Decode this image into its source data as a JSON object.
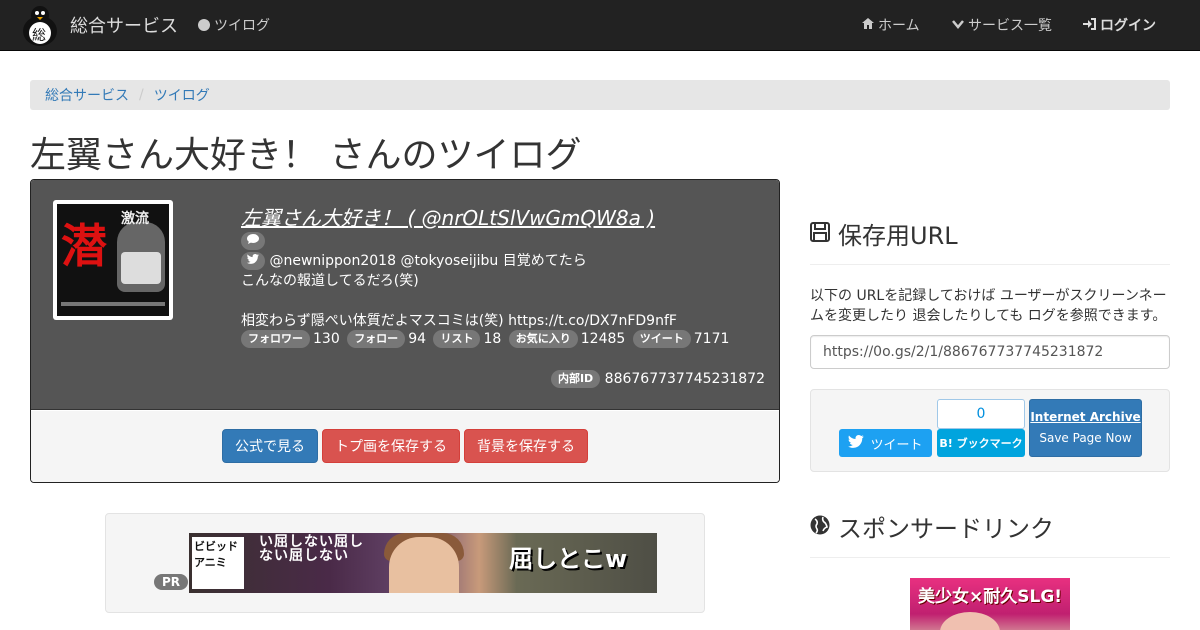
{
  "navbar": {
    "brand": "総合サービス",
    "logo_text": "総",
    "twilog_link": "ツイログ",
    "home": "ホーム",
    "services": "サービス一覧",
    "login": "ログイン"
  },
  "breadcrumb": [
    "総合サービス",
    "ツイログ"
  ],
  "page_title": "左翼さん大好き！ さんのツイログ",
  "profile": {
    "avatar_text": "潜",
    "avatar_tag": "激流",
    "display_name": "左翼さん大好き！ ( @nrOLtSlVwGmQW8a )",
    "tweet_line1": "@newnippon2018 @tokyoseijibu 目覚めてたら",
    "tweet_line2": "こんなの報道してるだろ(笑)",
    "tweet_line3": "相変わらず隠ぺい体質だよマスコミは(笑) https://t.co/DX7nFD9nfF",
    "stats": [
      {
        "label": "フォロワー",
        "value": "130"
      },
      {
        "label": "フォロー",
        "value": "94"
      },
      {
        "label": "リスト",
        "value": "18"
      },
      {
        "label": "お気に入り",
        "value": "12485"
      },
      {
        "label": "ツイート",
        "value": "7171"
      }
    ],
    "internal_id_label": "内部ID",
    "internal_id": "886767737745231872"
  },
  "buttons": {
    "official": "公式で見る",
    "save_icon": "トプ画を保存する",
    "save_bg": "背景を保存する"
  },
  "ad": {
    "pr": "PR",
    "logo_text": "ビビッドアニミ",
    "side_text": "い屈しない屈しない屈しない",
    "title": "屈しとこw"
  },
  "sidebar": {
    "save_url_heading": "保存用URL",
    "save_url_desc": "以下の URLを記録しておけば ユーザーがスクリーンネームを変更したり 退会したりしても ログを参照できます。",
    "save_url": "https://0o.gs/2/1/886767737745231872",
    "tweet_button": "ツイート",
    "hatena_count": "0",
    "hatena_button": "B! ブックマーク",
    "ia_title": "Internet Archive",
    "ia_sub": "Save Page Now",
    "sponsor_heading": "スポンサードリンク",
    "sponsor_ad_text": "美少女×耐久SLG!"
  },
  "colors": {
    "navbar_bg": "#222222",
    "primary": "#337ab7",
    "danger": "#d9534f",
    "twitter": "#1da1f2",
    "hatena": "#00a4de"
  }
}
